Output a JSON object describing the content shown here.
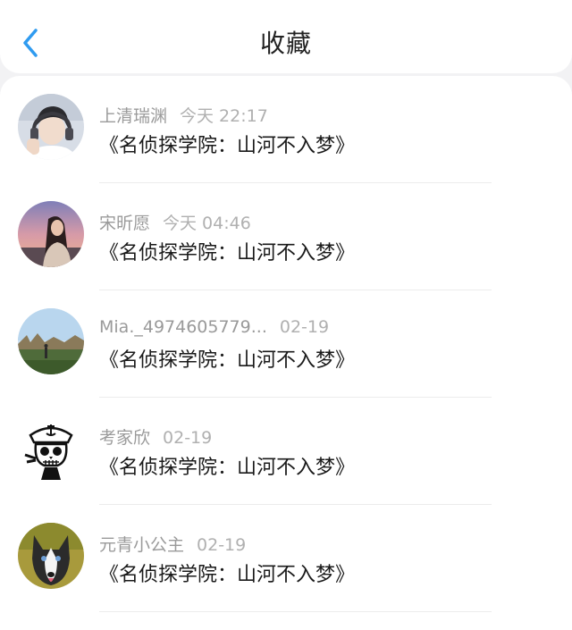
{
  "header": {
    "title": "收藏",
    "back_icon": "chevron-left-icon",
    "accent_color": "#2f9bf0"
  },
  "items": [
    {
      "user": "上清瑞渊",
      "time": "今天 22:17",
      "content": "《名侦探学院：山河不入梦》",
      "avatar": "portrait-headphones"
    },
    {
      "user": "宋昕愿",
      "time": "今天 04:46",
      "content": "《名侦探学院：山河不入梦》",
      "avatar": "portrait-sunset"
    },
    {
      "user": "Mia._4974605779...",
      "time": "02-19",
      "content": "《名侦探学院：山河不入梦》",
      "avatar": "landscape-field"
    },
    {
      "user": "考家欣",
      "time": "02-19",
      "content": "《名侦探学院：山河不入梦》",
      "avatar": "skull-sailor"
    },
    {
      "user": "元青小公主",
      "time": "02-19",
      "content": "《名侦探学院：山河不入梦》",
      "avatar": "dog-husky"
    }
  ]
}
